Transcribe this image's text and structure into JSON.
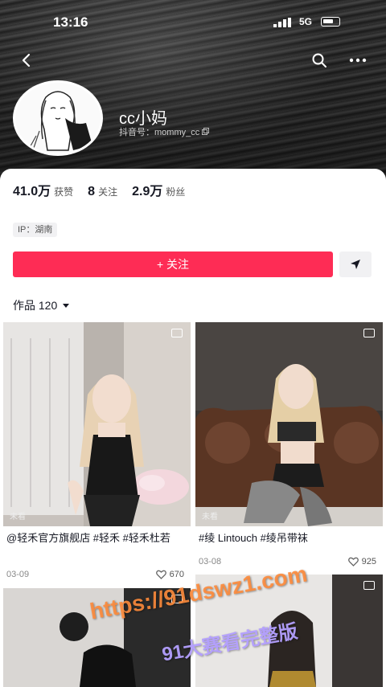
{
  "status_bar": {
    "time": "13:16",
    "network": "5G"
  },
  "profile": {
    "name": "cc小妈",
    "douyin_id_label": "抖音号：mommy_cc"
  },
  "stats": {
    "likes_value": "41.0万",
    "likes_label": "获赞",
    "following_value": "8",
    "following_label": "关注",
    "followers_value": "2.9万",
    "followers_label": "粉丝"
  },
  "ip_tag": "IP：湖南",
  "actions": {
    "follow_label": "+ 关注"
  },
  "works": {
    "label": "作品 120"
  },
  "videos": [
    {
      "caption": "@轻禾官方旗舰店 #轻禾 #轻禾杜若",
      "date": "03-09",
      "likes": "670",
      "unseen": "未看"
    },
    {
      "caption": "#绫 Lintouch #绫吊带袜",
      "date": "03-08",
      "likes": "925",
      "unseen": "未看"
    }
  ],
  "watermark": {
    "line1": "https://91dswz1.com",
    "line2": "91大赛看完整版"
  },
  "colors": {
    "accent": "#fe2c55",
    "text": "#161823"
  },
  "icons": [
    "back-icon",
    "search-icon",
    "more-icon",
    "share-icon",
    "dropdown-icon",
    "multi-image-icon",
    "heart-icon"
  ]
}
